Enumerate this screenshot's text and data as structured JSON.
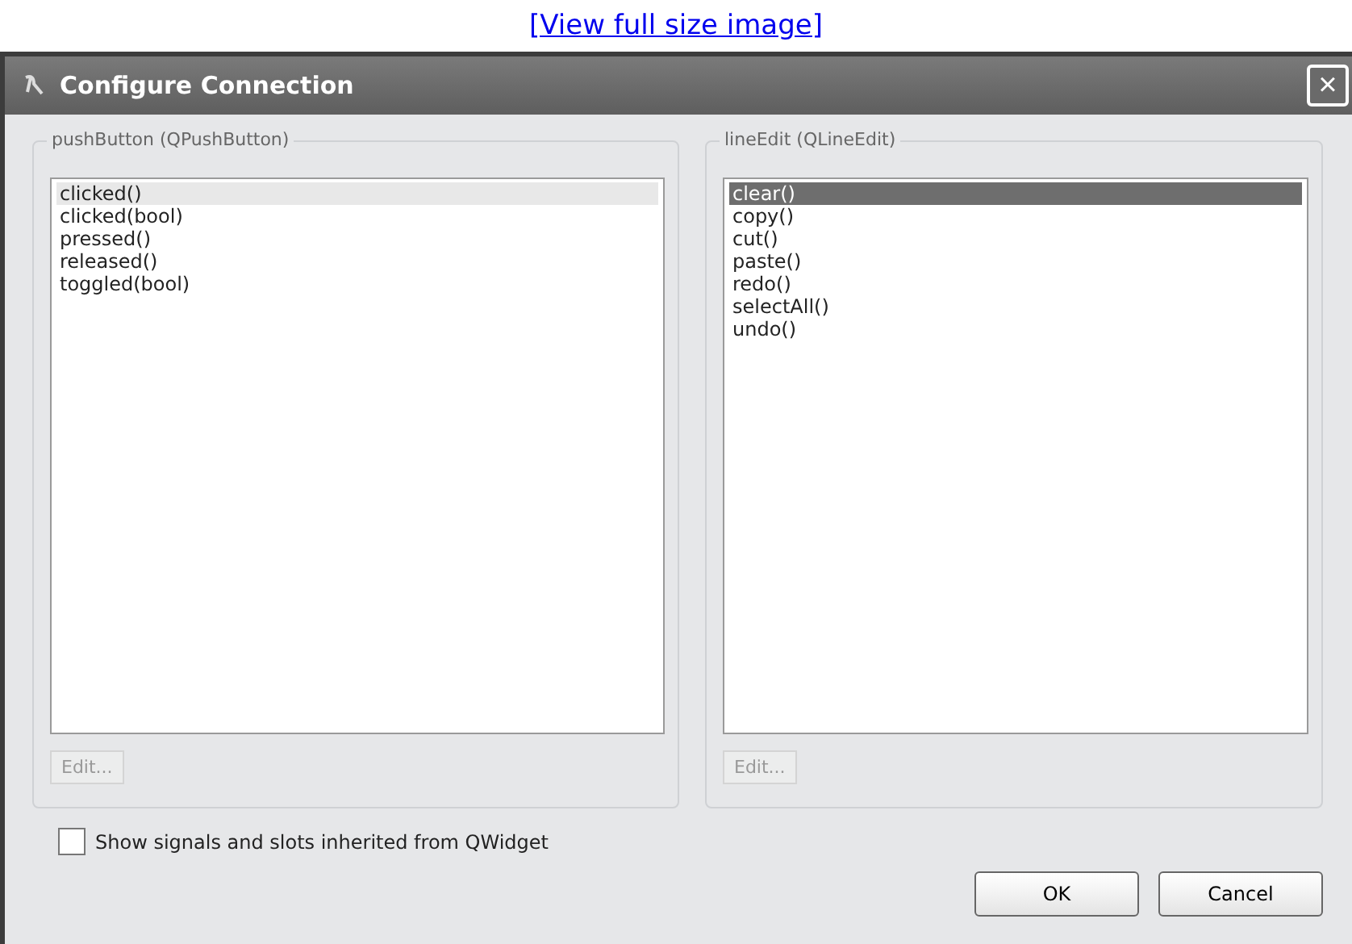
{
  "link": "[View full size image]",
  "window": {
    "title": "Configure Connection",
    "close": "×"
  },
  "groups": [
    {
      "title": "pushButton (QPushButton)",
      "focused": false,
      "edit_button": {
        "label": "Edit...",
        "disabled": true
      },
      "items": [
        {
          "label": "clicked()",
          "selected": true
        },
        {
          "label": "clicked(bool)",
          "selected": false
        },
        {
          "label": "pressed()",
          "selected": false
        },
        {
          "label": "released()",
          "selected": false
        },
        {
          "label": "toggled(bool)",
          "selected": false
        }
      ]
    },
    {
      "title": "lineEdit (QLineEdit)",
      "focused": true,
      "edit_button": {
        "label": "Edit...",
        "disabled": true
      },
      "items": [
        {
          "label": "clear()",
          "selected": true
        },
        {
          "label": "copy()",
          "selected": false
        },
        {
          "label": "cut()",
          "selected": false
        },
        {
          "label": "paste()",
          "selected": false
        },
        {
          "label": "redo()",
          "selected": false
        },
        {
          "label": "selectAll()",
          "selected": false
        },
        {
          "label": "undo()",
          "selected": false
        }
      ]
    }
  ],
  "inherited_checkbox": {
    "label": "Show signals and slots inherited from QWidget",
    "checked": false
  },
  "buttons": [
    "OK",
    "Cancel"
  ]
}
